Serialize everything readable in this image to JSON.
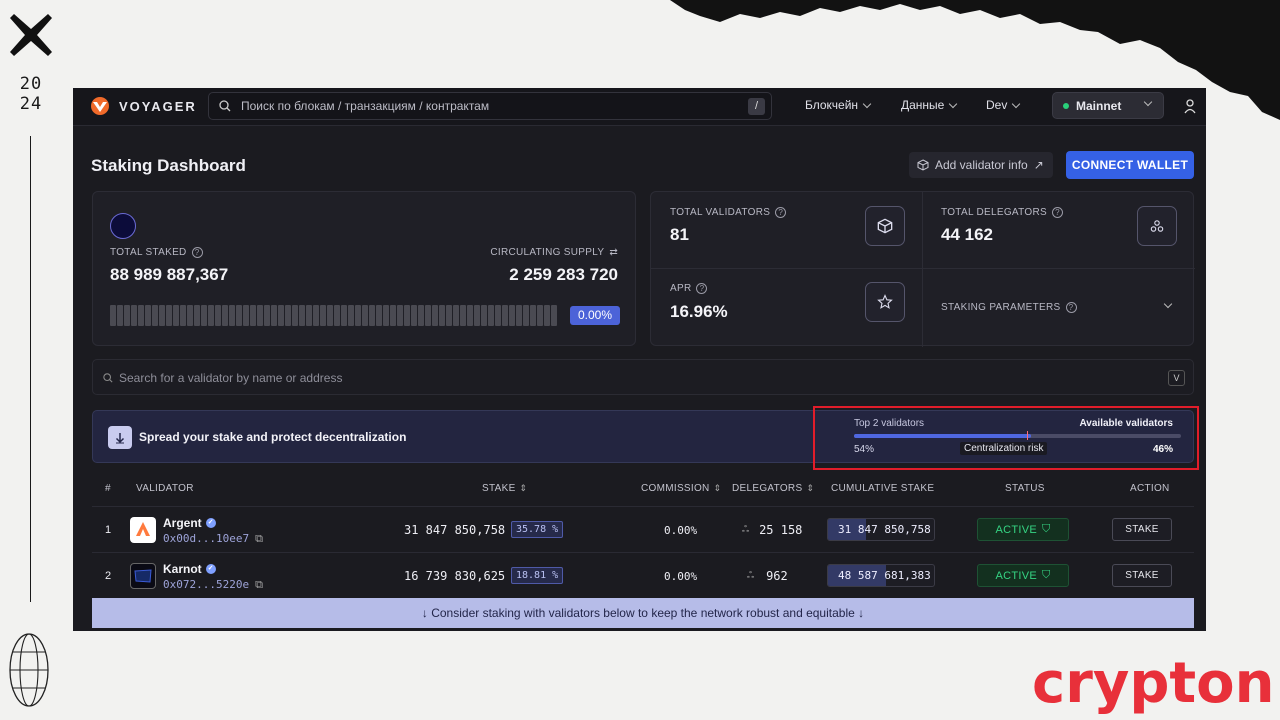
{
  "frame": {
    "year_top": "20",
    "year_bottom": "24",
    "brand_text": "crypton"
  },
  "nav": {
    "logo_text": "VOYAGER",
    "search_placeholder": "Поиск по блокам / транзакциям / контрактам",
    "search_shortcut": "/",
    "items": [
      "Блокчейн",
      "Данные",
      "Dev"
    ],
    "network": "Mainnet"
  },
  "header": {
    "title": "Staking Dashboard",
    "add_validator_label": "Add validator info",
    "connect_wallet_label": "CONNECT WALLET"
  },
  "staked": {
    "total_staked_label": "TOTAL STAKED",
    "total_staked_value": "88 989 887,367",
    "circulating_label": "CIRCULATING SUPPLY",
    "circulating_value": "2 259 283 720",
    "percent_badge": "0.00%"
  },
  "stats": {
    "total_validators_label": "TOTAL VALIDATORS",
    "total_validators_value": "81",
    "total_delegators_label": "TOTAL DELEGATORS",
    "total_delegators_value": "44 162",
    "apr_label": "APR",
    "apr_value": "16.96%",
    "staking_params_label": "STAKING PARAMETERS"
  },
  "validator_search": {
    "placeholder": "Search for a validator by name or address",
    "shortcut": "V"
  },
  "spread": {
    "text": "Spread your stake and protect decentralization",
    "top_label": "Top 2 validators",
    "available_label": "Available validators",
    "left_pct": "54%",
    "right_pct": "46%",
    "risk_label": "Centralization risk",
    "top_share_fraction": 0.54
  },
  "table": {
    "headers": {
      "index": "#",
      "validator": "VALIDATOR",
      "stake": "STAKE",
      "commission": "COMMISSION",
      "delegators": "DELEGATORS",
      "cumulative": "CUMULATIVE STAKE",
      "status": "STATUS",
      "action": "ACTION"
    },
    "rows": [
      {
        "index": "1",
        "name": "Argent",
        "address": "0x00d...10ee7",
        "stake": "31 847 850,758",
        "share": "35.78 %",
        "commission": "0.00%",
        "delegators": "25 158",
        "cumulative": "31 847 850,758",
        "cumulative_fraction": 0.36,
        "status": "ACTIVE",
        "action": "STAKE",
        "logo_color": "#ff7a3d"
      },
      {
        "index": "2",
        "name": "Karnot",
        "address": "0x072...5220e",
        "stake": "16 739 830,625",
        "share": "18.81 %",
        "commission": "0.00%",
        "delegators": "962",
        "cumulative": "48 587 681,383",
        "cumulative_fraction": 0.55,
        "status": "ACTIVE",
        "action": "STAKE",
        "logo_color": "#3b5bd6"
      }
    ],
    "consider_text": "↓ Consider staking with validators below to keep the network robust and equitable ↓"
  },
  "colors": {
    "accent": "#3561e6",
    "highlight_box": "#e11d2a",
    "active": "#35d483",
    "brand": "#e8303a"
  }
}
